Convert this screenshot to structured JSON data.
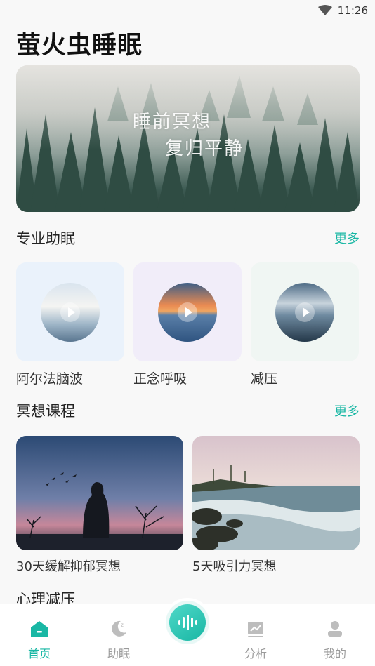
{
  "status_bar": {
    "time": "11:26"
  },
  "app": {
    "title": "萤火虫睡眠"
  },
  "banner": {
    "line1": "睡前冥想",
    "line2": "复归平静"
  },
  "sleep_section": {
    "title": "专业助眠",
    "more": "更多",
    "items": [
      {
        "label": "阿尔法脑波",
        "bg": "#eaf2fb"
      },
      {
        "label": "正念呼吸",
        "bg": "#f1edf9"
      },
      {
        "label": "减压",
        "bg": "#f0f6f3"
      }
    ]
  },
  "meditation_section": {
    "title": "冥想课程",
    "more": "更多",
    "courses": [
      {
        "label": "30天缓解抑郁冥想"
      },
      {
        "label": "5天吸引力冥想"
      }
    ]
  },
  "stress_section": {
    "title": "心理减压"
  },
  "tabbar": {
    "tabs": [
      {
        "label": "首页",
        "icon": "home-icon",
        "active": true
      },
      {
        "label": "助眠",
        "icon": "moon-icon",
        "active": false
      },
      {
        "label": "分析",
        "icon": "chart-icon",
        "active": false
      },
      {
        "label": "我的",
        "icon": "user-icon",
        "active": false
      }
    ],
    "center_icon": "sound-wave-icon"
  },
  "colors": {
    "accent": "#19b7a4"
  }
}
